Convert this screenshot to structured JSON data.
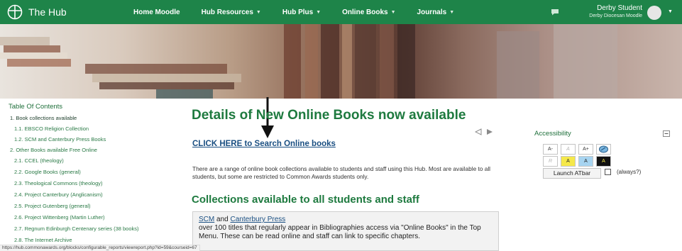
{
  "navbar": {
    "brand": "The Hub",
    "menu": [
      {
        "label": "Home Moodle",
        "has_caret": false
      },
      {
        "label": "Hub Resources",
        "has_caret": true
      },
      {
        "label": "Hub Plus",
        "has_caret": true
      },
      {
        "label": "Online Books",
        "has_caret": true
      },
      {
        "label": "Journals",
        "has_caret": true
      }
    ],
    "user_name": "Derby Student",
    "user_site": "Derby Diocesan Moodle"
  },
  "toc": {
    "title": "Table Of Contents",
    "items": [
      {
        "label": "1. Book collections available",
        "level": 1,
        "active": true
      },
      {
        "label": "1.1. EBSCO Religion Collection",
        "level": 2
      },
      {
        "label": "1.2. SCM and Canterbury Press Books",
        "level": 2
      },
      {
        "label": "2. Other Books available Free Online",
        "level": 1
      },
      {
        "label": "2.1. CCEL (theology)",
        "level": 2
      },
      {
        "label": "2.2. Google Books (general)",
        "level": 2
      },
      {
        "label": "2.3. Theological Commons (theology)",
        "level": 2
      },
      {
        "label": "2.4. Project Canterbury (Anglicanism)",
        "level": 2
      },
      {
        "label": "2.5. Project Gutenberg (general)",
        "level": 2
      },
      {
        "label": "2.6. Project Wittenberg (Martin Luther)",
        "level": 2
      },
      {
        "label": "2.7. Regnum Edinburgh Centenary series (38 books)",
        "level": 2
      },
      {
        "label": "2.8. The Internet Archive",
        "level": 2
      }
    ]
  },
  "main": {
    "title": "Details of New Online Books now available",
    "search_link": "CLICK HERE to Search Online books",
    "intro": "There are a range of online book collections available to students and staff using this Hub. Most are available to all students, but some are restricted to Common Awards students only.",
    "section_heading": "Collections available to all students and staff",
    "card": {
      "link1": "SCM",
      "and": " and ",
      "link2": "Canterbury Press",
      "desc": "over 100 titles that regularly appear in Bibliographies access via \"Online Books\" in the Top Menu. These can be read online and staff can link to specific chapters."
    }
  },
  "accessibility": {
    "title": "Accessibility",
    "font_buttons": [
      "A-",
      "A",
      "A+"
    ],
    "color_buttons": [
      "R",
      "A",
      "A",
      "A"
    ],
    "launch_label": "Launch ATbar",
    "always_label": "(always?)"
  },
  "status_url": "https://hub.commonawards.org/blocks/configurable_reports/viewreport.php?id=59&courseid=67",
  "colors": {
    "navbar": "#1e8449",
    "heading": "#1e7a3f",
    "link": "#1a4f82"
  }
}
